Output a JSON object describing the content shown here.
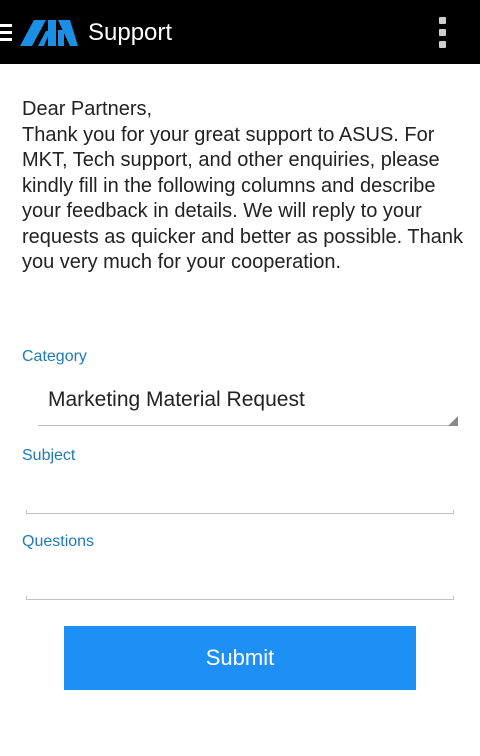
{
  "appbar": {
    "title": "Support",
    "menu_icon": "hamburger-menu-icon",
    "logo": "asus-logo",
    "overflow_icon": "overflow-menu-icon",
    "background_color": "#000000"
  },
  "intro": {
    "greeting": "Dear Partners,",
    "body": "Thank you for your great support to ASUS. For MKT, Tech support, and other enquiries, please kindly fill in the following columns and describe your feedback in details. We will reply to your requests as quicker and better as possible. Thank you very much for your cooperation."
  },
  "form": {
    "category": {
      "label": "Category",
      "selected": "Marketing Material Request"
    },
    "subject": {
      "label": "Subject",
      "value": ""
    },
    "questions": {
      "label": "Questions",
      "value": ""
    },
    "submit_label": "Submit"
  },
  "colors": {
    "label_blue": "#1e7ab8",
    "submit_blue": "#1e90f5"
  }
}
